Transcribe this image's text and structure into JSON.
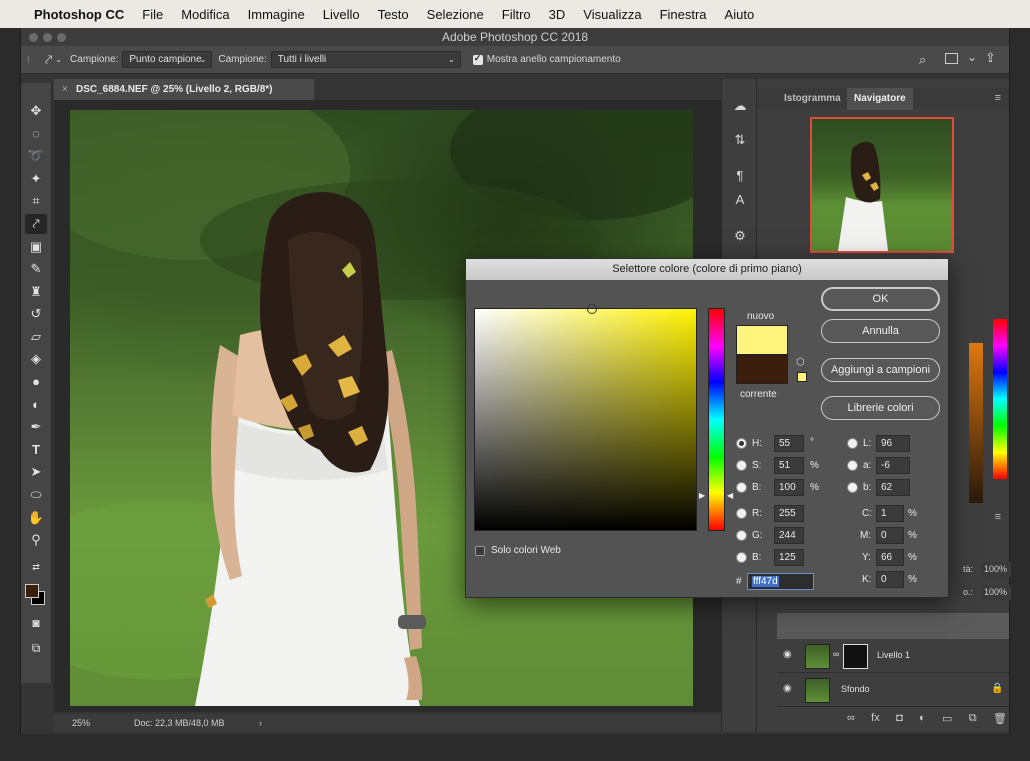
{
  "menubar": {
    "app_name": "Photoshop CC",
    "items": [
      "File",
      "Modifica",
      "Immagine",
      "Livello",
      "Testo",
      "Selezione",
      "Filtro",
      "3D",
      "Visualizza",
      "Finestra",
      "Aiuto"
    ]
  },
  "window": {
    "title": "Adobe Photoshop CC 2018"
  },
  "options_bar": {
    "sample_label": "Campione:",
    "sample_value": "Punto campione",
    "sample2_label": "Campione:",
    "sample2_value": "Tutti i livelli",
    "ring_label": "Mostra anello campionamento"
  },
  "document": {
    "tab_title": "DSC_6884.NEF @ 25% (Livello 2, RGB/8*)",
    "tab_close": "×",
    "zoom": "25%",
    "doc_info": "Doc: 22,3 MB/48,0 MB",
    "status_arrow": "›"
  },
  "panels": {
    "tab_histogram": "Istogramma",
    "tab_navigator": "Navigatore",
    "layers": [
      {
        "name": "Livello 1"
      },
      {
        "name": "Sfondo"
      }
    ],
    "opacity_value": "100%",
    "fill_value": "100%",
    "opacity_label": "tà:",
    "fill_label": "o.:"
  },
  "color_picker": {
    "title": "Selettore colore (colore di primo piano)",
    "new_label": "nuovo",
    "current_label": "corrente",
    "new_color": "#fff47d",
    "current_color": "#3b1e0c",
    "buttons": {
      "ok": "OK",
      "cancel": "Annulla",
      "add_swatches": "Aggiungi a campioni",
      "libraries": "Librerie colori"
    },
    "web_only_label": "Solo colori Web",
    "fields": {
      "H": {
        "label": "H:",
        "value": "55",
        "unit": "°"
      },
      "S": {
        "label": "S:",
        "value": "51",
        "unit": "%"
      },
      "Bri": {
        "label": "B:",
        "value": "100",
        "unit": "%"
      },
      "R": {
        "label": "R:",
        "value": "255"
      },
      "G": {
        "label": "G:",
        "value": "244"
      },
      "Blu": {
        "label": "B:",
        "value": "125"
      },
      "L": {
        "label": "L:",
        "value": "96"
      },
      "a": {
        "label": "a:",
        "value": "-6"
      },
      "b": {
        "label": "b:",
        "value": "62"
      },
      "C": {
        "label": "C:",
        "value": "1",
        "unit": "%"
      },
      "M": {
        "label": "M:",
        "value": "0",
        "unit": "%"
      },
      "Y": {
        "label": "Y:",
        "value": "66",
        "unit": "%"
      },
      "K": {
        "label": "K:",
        "value": "0",
        "unit": "%"
      }
    },
    "hex_label": "#",
    "hex_value": "fff47d"
  },
  "colors": {
    "foreground": "#3b1e0c",
    "background": "#000000",
    "navigator_frame": "#e34a3a"
  },
  "icons": {
    "apple": "apple-logo-icon",
    "eyedropper": "eyedropper-icon",
    "search": "search-icon",
    "workspace": "workspace-icon",
    "share": "share-icon"
  }
}
